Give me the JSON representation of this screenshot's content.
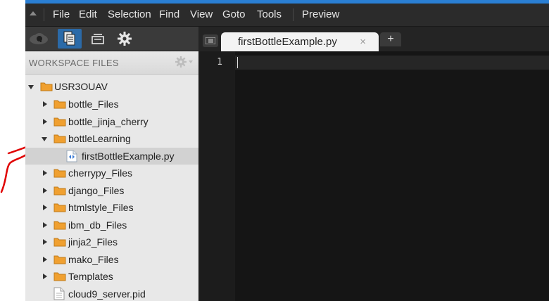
{
  "menu": {
    "items": [
      {
        "label": "File"
      },
      {
        "label": "Edit"
      },
      {
        "label": "Selection"
      },
      {
        "label": "Find"
      },
      {
        "label": "View"
      },
      {
        "label": "Goto"
      },
      {
        "label": "Tools"
      }
    ],
    "preview_label": "Preview"
  },
  "toolbar": {
    "icons": [
      "cloud9-icon",
      "workspace-files-icon",
      "open-files-icon",
      "gear-icon"
    ],
    "active_icon": "workspace-files-icon"
  },
  "sidebar": {
    "header": "WORKSPACE FILES",
    "tree": [
      {
        "label": "USR3OUAV",
        "type": "folder",
        "expanded": true
      },
      {
        "label": "bottle_Files",
        "type": "folder",
        "expanded": false
      },
      {
        "label": "bottle_jinja_cherry",
        "type": "folder",
        "expanded": false
      },
      {
        "label": "bottleLearning",
        "type": "folder",
        "expanded": true
      },
      {
        "label": "firstBottleExample.py",
        "type": "file-py",
        "selected": true
      },
      {
        "label": "cherrypy_Files",
        "type": "folder",
        "expanded": false
      },
      {
        "label": "django_Files",
        "type": "folder",
        "expanded": false
      },
      {
        "label": "htmlstyle_Files",
        "type": "folder",
        "expanded": false
      },
      {
        "label": "ibm_db_Files",
        "type": "folder",
        "expanded": false
      },
      {
        "label": "jinja2_Files",
        "type": "folder",
        "expanded": false
      },
      {
        "label": "mako_Files",
        "type": "folder",
        "expanded": false
      },
      {
        "label": "Templates",
        "type": "folder",
        "expanded": false
      },
      {
        "label": "cloud9_server.pid",
        "type": "file"
      }
    ]
  },
  "editor": {
    "tab_label": "firstBottleExample.py",
    "close_glyph": "×",
    "new_tab_glyph": "+",
    "line_numbers": [
      "1"
    ]
  },
  "colors": {
    "accent": "#2a7fd4",
    "menubar_bg": "#2b2b2b",
    "sidebar_bg": "#e8e8e8",
    "folder": "#f0a030",
    "editor_bg": "#151515",
    "annotation_red": "#e00000"
  }
}
